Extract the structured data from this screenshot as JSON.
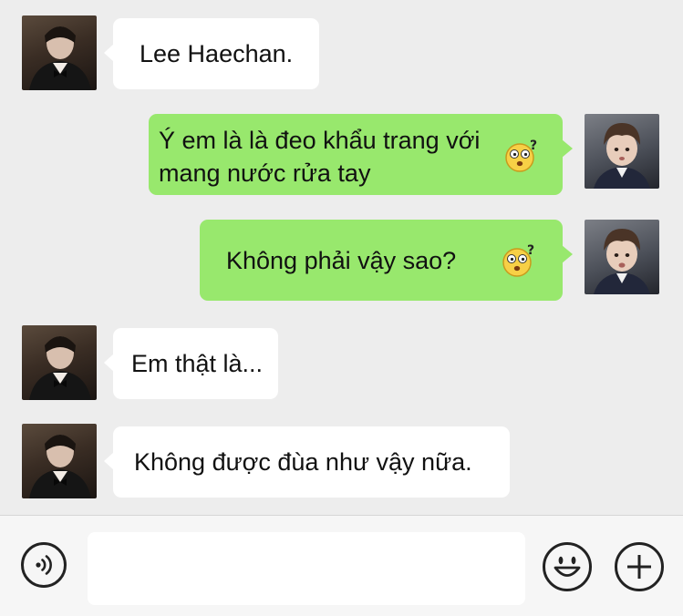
{
  "messages": [
    {
      "side": "left",
      "text": "Lee Haechan."
    },
    {
      "side": "right",
      "lines": [
        "Ý em là là đeo khẩu trang với",
        "mang nước rửa tay"
      ],
      "emoji": "confused-face-emoji"
    },
    {
      "side": "right",
      "text": "Không phải vậy sao?",
      "emoji": "confused-face-emoji"
    },
    {
      "side": "left",
      "text": "Em thật là..."
    },
    {
      "side": "left",
      "text": "Không được đùa như vậy nữa."
    }
  ],
  "input_bar": {
    "voice_icon": "voice-icon",
    "emoji_icon": "smiley-icon",
    "plus_icon": "plus-icon",
    "input_value": ""
  },
  "colors": {
    "background": "#ededed",
    "bubble_sent": "#98e86d",
    "bubble_received": "#ffffff"
  }
}
